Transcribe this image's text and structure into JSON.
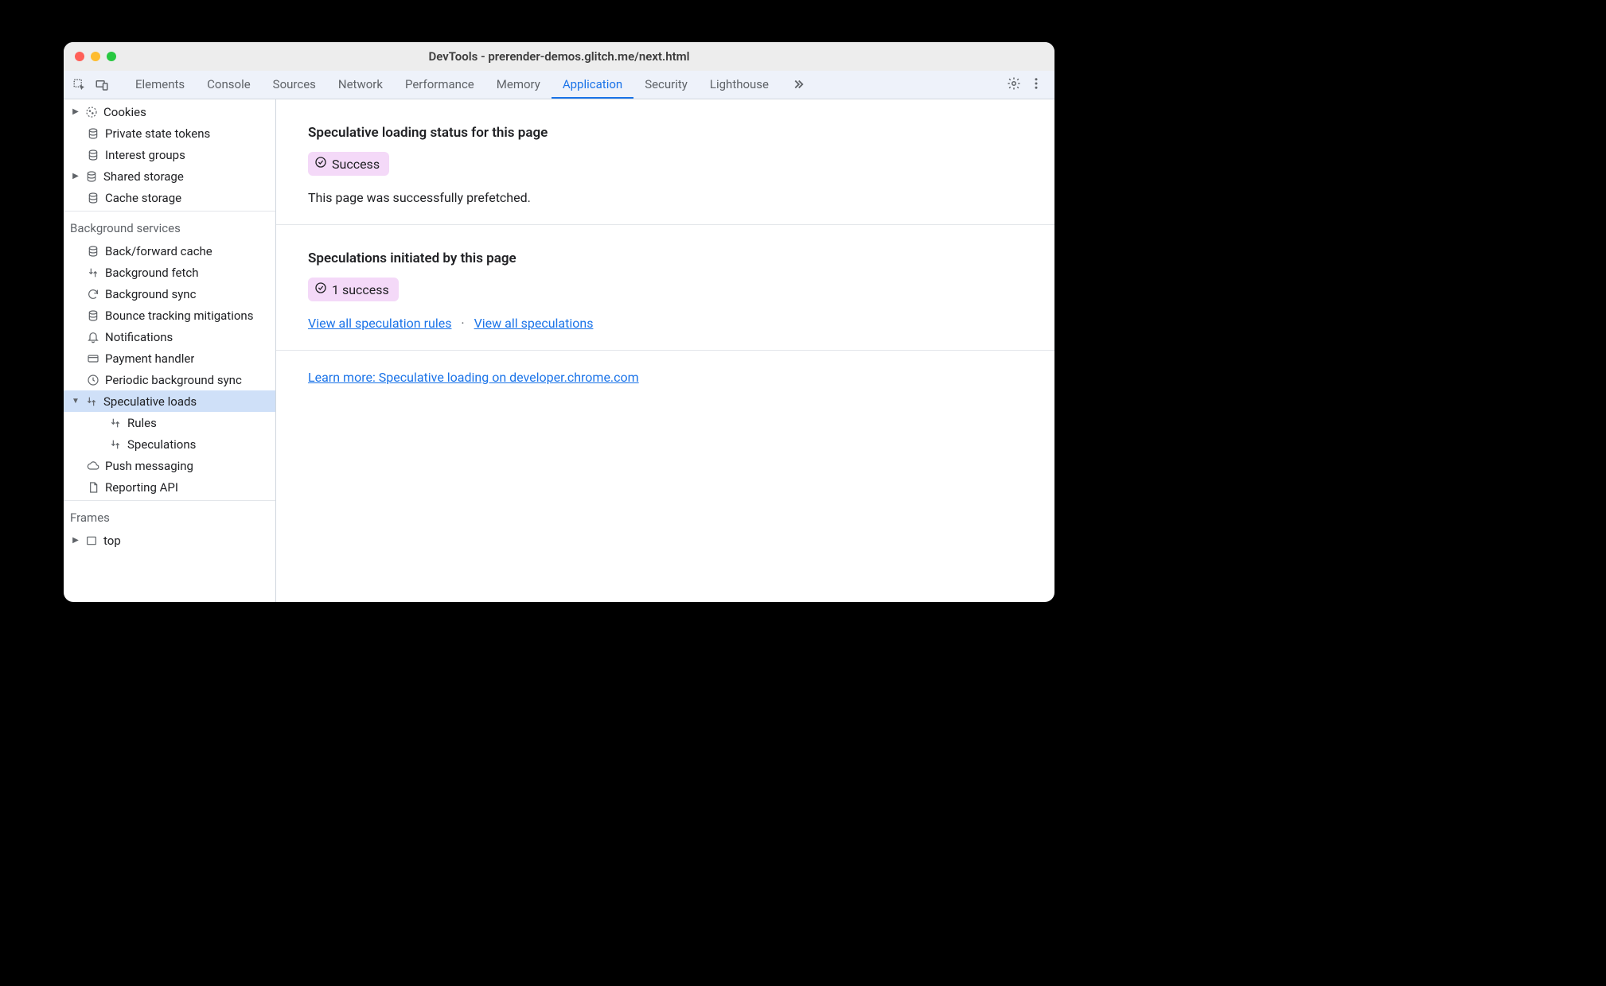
{
  "window_title": "DevTools - prerender-demos.glitch.me/next.html",
  "tabs": {
    "elements": "Elements",
    "console": "Console",
    "sources": "Sources",
    "network": "Network",
    "performance": "Performance",
    "memory": "Memory",
    "application": "Application",
    "security": "Security",
    "lighthouse": "Lighthouse"
  },
  "sidebar": {
    "storage": {
      "cookies": "Cookies",
      "private_state_tokens": "Private state tokens",
      "interest_groups": "Interest groups",
      "shared_storage": "Shared storage",
      "cache_storage": "Cache storage"
    },
    "background_services": {
      "header": "Background services",
      "back_forward_cache": "Back/forward cache",
      "background_fetch": "Background fetch",
      "background_sync": "Background sync",
      "bounce_tracking": "Bounce tracking mitigations",
      "notifications": "Notifications",
      "payment_handler": "Payment handler",
      "periodic_bg_sync": "Periodic background sync",
      "speculative_loads": "Speculative loads",
      "rules": "Rules",
      "speculations": "Speculations",
      "push_messaging": "Push messaging",
      "reporting_api": "Reporting API"
    },
    "frames": {
      "header": "Frames",
      "top": "top"
    }
  },
  "main": {
    "status_heading": "Speculative loading status for this page",
    "status_badge": "Success",
    "status_text": "This page was successfully prefetched.",
    "initiated_heading": "Speculations initiated by this page",
    "initiated_badge": "1 success",
    "view_rules": "View all speculation rules",
    "view_speculations": "View all speculations",
    "learn_more": "Learn more: Speculative loading on developer.chrome.com"
  }
}
